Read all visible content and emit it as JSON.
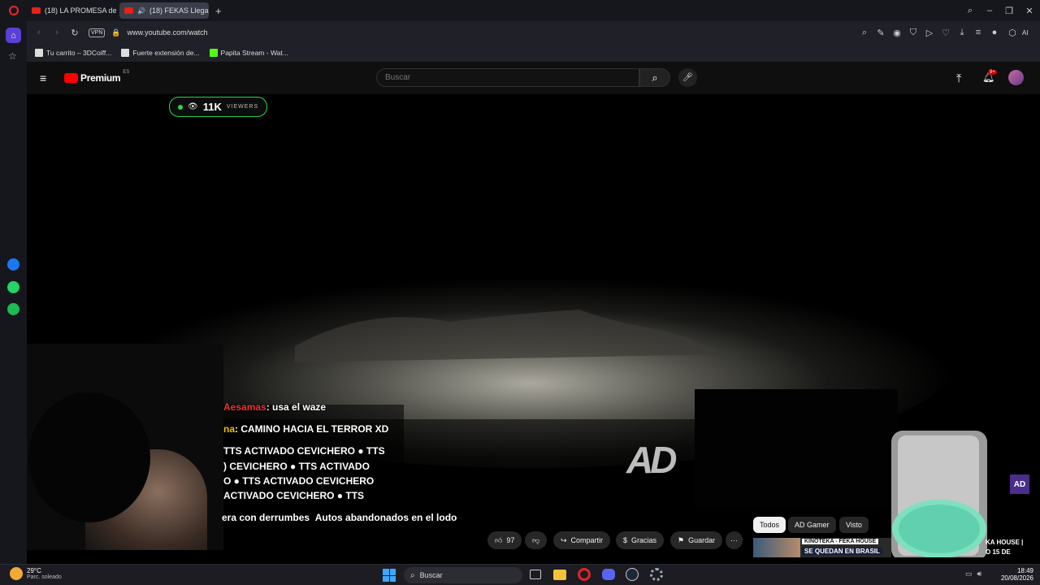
{
  "browser": {
    "tabs": [
      {
        "label": "(18) LA PROMESA de King"
      },
      {
        "label": "(18) FEKAS Llegan a la"
      }
    ],
    "new_tab": "+",
    "url": "www.youtube.com/watch",
    "vpn": "VPN",
    "ai_label": "AI",
    "bookmarks": [
      {
        "label": "Tu carrito – 3DCoiff..."
      },
      {
        "label": "Fuerte extensión de..."
      },
      {
        "label": "Papita Stream - Wat..."
      }
    ]
  },
  "youtube": {
    "logo": "Premium",
    "logo_region": "ES",
    "search_placeholder": "Buscar",
    "notif_badge": "9+"
  },
  "stream": {
    "viewers": "11K",
    "viewers_label": "VIEWERS",
    "watermark": "AD",
    "corner_logo": "AD",
    "chat": [
      {
        "user": "Aesamas",
        "text": ": usa el waze"
      },
      {
        "user": "na",
        "text": ": CAMINO HACIA EL TERROR XD"
      },
      {
        "user": "",
        "text": "TTS ACTIVADO CEVICHERO ● TTS"
      },
      {
        "user": "",
        "text": ") CEVICHERO ● TTS ACTIVADO"
      },
      {
        "user": "",
        "text": "O ● TTS ACTIVADO CEVICHERO"
      },
      {
        "user": "",
        "text": "ACTIVADO CEVICHERO ● TTS"
      }
    ],
    "title": "era con derrumbes  Autos abandonados en el lodo"
  },
  "actions": {
    "likes": "97",
    "share": "Compartir",
    "thanks": "Gracias",
    "save": "Guardar",
    "more": "···"
  },
  "chips": [
    "Todos",
    "AD Gamer",
    "Visto"
  ],
  "recommended": {
    "thumb_top": "KINOTEKA - FEKA HOUSE",
    "thumb_bottom": "SE QUEDAN EN BRASIL",
    "title_fragment_1": "KA HOUSE |",
    "title_fragment_2": "O 15 DE"
  },
  "taskbar": {
    "temp": "29°C",
    "weather": "Parc. soleado",
    "search": "Buscar",
    "time": "18:49",
    "date": "20/08/2026"
  },
  "colors": {
    "accent_red": "#e62117",
    "live_green": "#2fd34a",
    "browser_bg": "#16171d"
  }
}
